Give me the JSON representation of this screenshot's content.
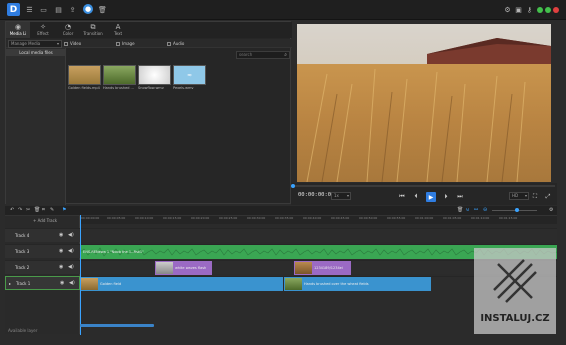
{
  "titlebar": {
    "colors": {
      "close": "#e04040",
      "maximize": "#43c04c",
      "minimize": "#43c04c"
    },
    "icons": [
      "new-icon",
      "open-icon",
      "save-icon",
      "export-icon",
      "user-icon",
      "delete-icon"
    ],
    "right_icons": [
      "settings-icon",
      "cart-icon",
      "key-icon"
    ]
  },
  "media_tabs": [
    {
      "label": "Media Li",
      "icon": "media-library-icon"
    },
    {
      "label": "Effect",
      "icon": "effect-icon"
    },
    {
      "label": "Color",
      "icon": "color-icon"
    },
    {
      "label": "Transition",
      "icon": "transition-icon"
    },
    {
      "label": "Text",
      "icon": "text-icon"
    }
  ],
  "filter": {
    "manage": "Manage Media",
    "video": "Video",
    "image": "Image",
    "audio": "Audio"
  },
  "sidebar": {
    "local_files": "Local media files"
  },
  "search": {
    "placeholder": "search"
  },
  "media_items": [
    {
      "caption": "Golden fields.mp4",
      "color": "#b08a40"
    },
    {
      "caption": "Hands brushed ...",
      "color": "#6f8a3a"
    },
    {
      "caption": "Snowflow.wmv",
      "color": "#dcdcdc"
    },
    {
      "caption": "Pexels.wmv",
      "color": "#8fc8e8"
    }
  ],
  "player": {
    "timecode": "00:00:00:01",
    "speed": "1x",
    "quality": "HD"
  },
  "timeline": {
    "ticks": [
      "00:00:00:00",
      "00:00:05:00",
      "00:00:10:00",
      "00:00:15:00",
      "00:00:20:00",
      "00:00:25:00",
      "00:00:30:00",
      "00:00:35:00",
      "00:00:40:00",
      "00:00:45:00",
      "00:00:50:00",
      "00:00:55:00",
      "00:01:00:00",
      "00:01:05:00",
      "00:01:10:00",
      "00:01:15:00"
    ],
    "add_track": "Add Track",
    "tracks": [
      {
        "name": "Track 4"
      },
      {
        "name": "Track 3"
      },
      {
        "name": "Track 2"
      },
      {
        "name": "Track 1"
      }
    ],
    "clips": {
      "audio": "ENS-RENewa 1 \"Noob the 1--Rsk1\"",
      "t2a": "white waves flash",
      "t2b": "1234189/1234ei",
      "t1a": "Golden field",
      "t1b": "Hands brushed over the wheat fields"
    }
  },
  "status": {
    "text": "Available layer"
  },
  "watermark": {
    "text": "INSTALUJ.CZ"
  }
}
